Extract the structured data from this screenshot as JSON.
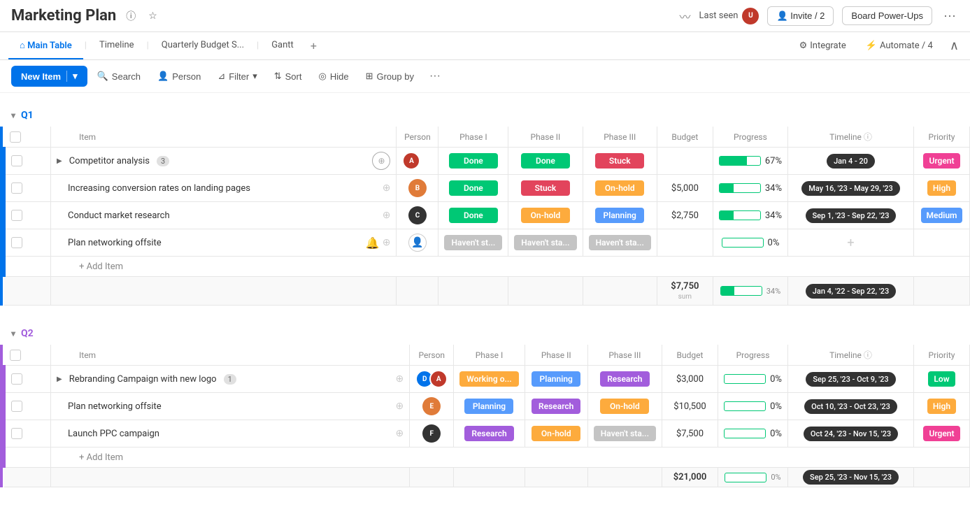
{
  "header": {
    "title": "Marketing Plan",
    "last_seen_label": "Last seen",
    "invite_label": "Invite / 2",
    "power_ups_label": "Board Power-Ups",
    "more_label": "..."
  },
  "tabs": [
    {
      "label": "Main Table",
      "active": true
    },
    {
      "label": "Timeline"
    },
    {
      "label": "Quarterly Budget S..."
    },
    {
      "label": "Gantt"
    }
  ],
  "tabs_right": {
    "integrate_label": "Integrate",
    "automate_label": "Automate / 4"
  },
  "toolbar": {
    "new_item_label": "New Item",
    "search_label": "Search",
    "person_label": "Person",
    "filter_label": "Filter",
    "sort_label": "Sort",
    "hide_label": "Hide",
    "group_by_label": "Group by"
  },
  "columns": {
    "item": "Item",
    "person": "Person",
    "phase1": "Phase I",
    "phase2": "Phase II",
    "phase3": "Phase III",
    "budget": "Budget",
    "progress": "Progress",
    "timeline": "Timeline",
    "priority": "Priority"
  },
  "q1": {
    "label": "Q1",
    "rows": [
      {
        "id": "r1",
        "item": "Competitor analysis",
        "sub_count": 3,
        "has_children": true,
        "phase1": "Done",
        "phase1_class": "badge-done",
        "phase2": "Done",
        "phase2_class": "badge-done",
        "phase3": "Stuck",
        "phase3_class": "badge-stuck",
        "budget": "",
        "progress": 67,
        "timeline": "Jan 4 - 20",
        "priority": "Urgent",
        "priority_class": "priority-urgent"
      },
      {
        "id": "r2",
        "item": "Increasing conversion rates on landing pages",
        "has_children": false,
        "phase1": "Done",
        "phase1_class": "badge-done",
        "phase2": "Stuck",
        "phase2_class": "badge-stuck",
        "phase3": "On-hold",
        "phase3_class": "badge-onhold",
        "budget": "$5,000",
        "progress": 34,
        "timeline": "May 16, '23 - May 29, '23",
        "priority": "High",
        "priority_class": "priority-high"
      },
      {
        "id": "r3",
        "item": "Conduct market research",
        "has_children": false,
        "phase1": "Done",
        "phase1_class": "badge-done",
        "phase2": "On-hold",
        "phase2_class": "badge-onhold",
        "phase3": "Planning",
        "phase3_class": "badge-planning",
        "budget": "$2,750",
        "progress": 34,
        "timeline": "Sep 1, '23 - Sep 22, '23",
        "priority": "Medium",
        "priority_class": "priority-medium"
      },
      {
        "id": "r4",
        "item": "Plan networking offsite",
        "has_children": false,
        "phase1": "Haven't st...",
        "phase1_class": "badge-havent",
        "phase2": "Haven't sta...",
        "phase2_class": "badge-havent",
        "phase3": "Haven't sta...",
        "phase3_class": "badge-havent",
        "budget": "",
        "progress": 0,
        "timeline": "",
        "priority": "",
        "priority_class": ""
      }
    ],
    "sum": {
      "budget": "$7,750",
      "progress": 34,
      "timeline": "Jan 4, '22 - Sep 22, '23"
    },
    "add_item_label": "+ Add Item"
  },
  "q2": {
    "label": "Q2",
    "rows": [
      {
        "id": "r5",
        "item": "Rebranding Campaign with new logo",
        "sub_count": 1,
        "has_children": true,
        "phase1": "Working o...",
        "phase1_class": "badge-working",
        "phase2": "Planning",
        "phase2_class": "badge-planning",
        "phase3": "Research",
        "phase3_class": "badge-research",
        "budget": "$3,000",
        "progress": 0,
        "timeline": "Sep 25, '23 - Oct 9, '23",
        "priority": "Low",
        "priority_class": "priority-low"
      },
      {
        "id": "r6",
        "item": "Plan networking offsite",
        "has_children": false,
        "phase1": "Planning",
        "phase1_class": "badge-planning",
        "phase2": "Research",
        "phase2_class": "badge-research",
        "phase3": "On-hold",
        "phase3_class": "badge-onhold",
        "budget": "$10,500",
        "progress": 0,
        "timeline": "Oct 10, '23 - Oct 23, '23",
        "priority": "High",
        "priority_class": "priority-high"
      },
      {
        "id": "r7",
        "item": "Launch PPC campaign",
        "has_children": false,
        "phase1": "Research",
        "phase1_class": "badge-research",
        "phase2": "On-hold",
        "phase2_class": "badge-onhold",
        "phase3": "Haven't sta...",
        "phase3_class": "badge-havent",
        "budget": "$7,500",
        "progress": 0,
        "timeline": "Oct 24, '23 - Nov 15, '23",
        "priority": "Urgent",
        "priority_class": "priority-urgent"
      }
    ],
    "sum": {
      "budget": "$21,000",
      "progress": 0,
      "timeline": "Sep 25, '23 - Nov 15, '23"
    },
    "add_item_label": "+ Add Item"
  }
}
